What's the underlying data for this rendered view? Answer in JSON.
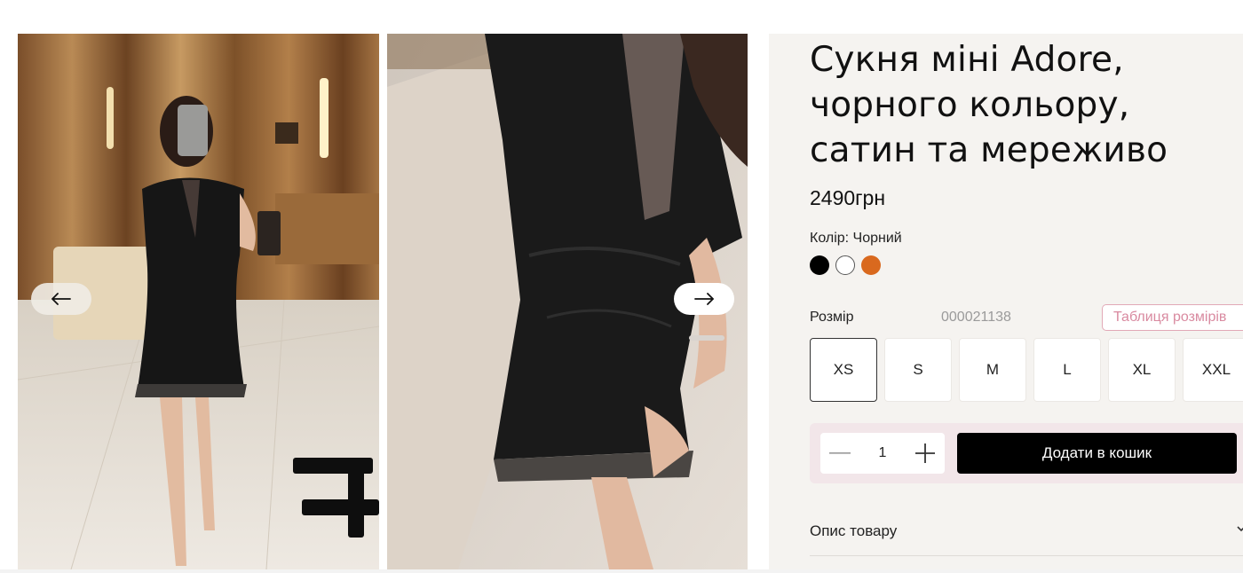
{
  "product": {
    "title": "Сукня міні Adore, чорного кольору, сатин та мереживо",
    "price": "2490грн",
    "color_label": "Колір: Чорний",
    "colors": [
      {
        "name": "black",
        "hex": "#000000"
      },
      {
        "name": "white",
        "hex": "#ffffff"
      },
      {
        "name": "orange",
        "hex": "#d9691e"
      }
    ],
    "size_label": "Розмір",
    "sku": "000021138",
    "size_table_label": "Таблиця розмірів",
    "sizes": [
      "XS",
      "S",
      "M",
      "L",
      "XL",
      "XXL"
    ],
    "selected_size": "XS",
    "quantity": "1",
    "add_to_cart_label": "Додати в кошик",
    "description_label": "Опис товару"
  },
  "gallery": {
    "prev_icon": "arrow-left-icon",
    "next_icon": "arrow-right-icon"
  },
  "icons": {
    "minus": "minus-icon",
    "plus": "plus-icon",
    "chevron": "chevron-down-icon"
  },
  "colors": {
    "cart_bar_bg": "#f2e6e9",
    "panel_bg": "#f5f3f0",
    "size_table_accent": "#d98aa0",
    "button_bg": "#000000"
  }
}
